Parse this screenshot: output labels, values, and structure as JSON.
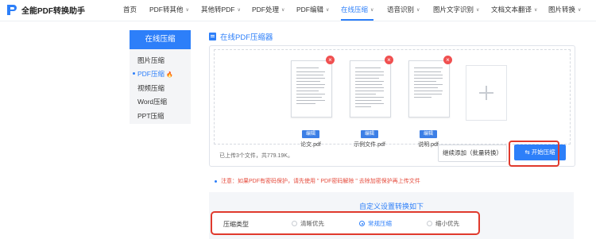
{
  "app": {
    "name": "全能PDF转换助手"
  },
  "nav": [
    {
      "label": "首页",
      "has_dropdown": false,
      "active": false
    },
    {
      "label": "PDF转其他",
      "has_dropdown": true,
      "active": false
    },
    {
      "label": "其他转PDF",
      "has_dropdown": true,
      "active": false
    },
    {
      "label": "PDF处理",
      "has_dropdown": true,
      "active": false
    },
    {
      "label": "PDF编辑",
      "has_dropdown": true,
      "active": false
    },
    {
      "label": "在线压缩",
      "has_dropdown": true,
      "active": true
    },
    {
      "label": "语音识别",
      "has_dropdown": true,
      "active": false
    },
    {
      "label": "图片文字识别",
      "has_dropdown": true,
      "active": false
    },
    {
      "label": "文档文本翻译",
      "has_dropdown": true,
      "active": false
    },
    {
      "label": "图片转换",
      "has_dropdown": true,
      "active": false
    }
  ],
  "sidebar": {
    "header": "在线压缩",
    "items": [
      {
        "label": "图片压缩",
        "active": false
      },
      {
        "label": "PDF压缩",
        "active": true,
        "hot": true
      },
      {
        "label": "视频压缩",
        "active": false
      },
      {
        "label": "Word压缩",
        "active": false
      },
      {
        "label": "PPT压缩",
        "active": false
      }
    ]
  },
  "main": {
    "title": "在线PDF压缩器",
    "files": [
      {
        "name": "论文.pdf",
        "edit_label": "编辑"
      },
      {
        "name": "示例文件.pdf",
        "edit_label": "编辑"
      },
      {
        "name": "说明.pdf",
        "edit_label": "编辑"
      }
    ],
    "upload_summary": "已上传3个文件，共779.19K。",
    "add_button": "继续添加（批量转换）",
    "start_button": "开始压缩",
    "notice": "注意：如果PDF有密码保护，请先使用 \" PDF密码解除 \" 去除加密保护再上传文件"
  },
  "settings": {
    "title": "自定义设置转换如下",
    "row_label": "压缩类型",
    "options": [
      {
        "label": "清晰优先",
        "selected": false
      },
      {
        "label": "常规压缩",
        "selected": true
      },
      {
        "label": "缩小优先",
        "selected": false
      }
    ]
  },
  "colors": {
    "accent": "#2d7ff9",
    "highlight": "#e03a2d",
    "delete": "#f05050"
  },
  "icons": [
    "logo-icon",
    "document-icon",
    "delete-icon",
    "add-plus-icon",
    "fire-icon",
    "swap-icon",
    "chevron-down-icon"
  ]
}
